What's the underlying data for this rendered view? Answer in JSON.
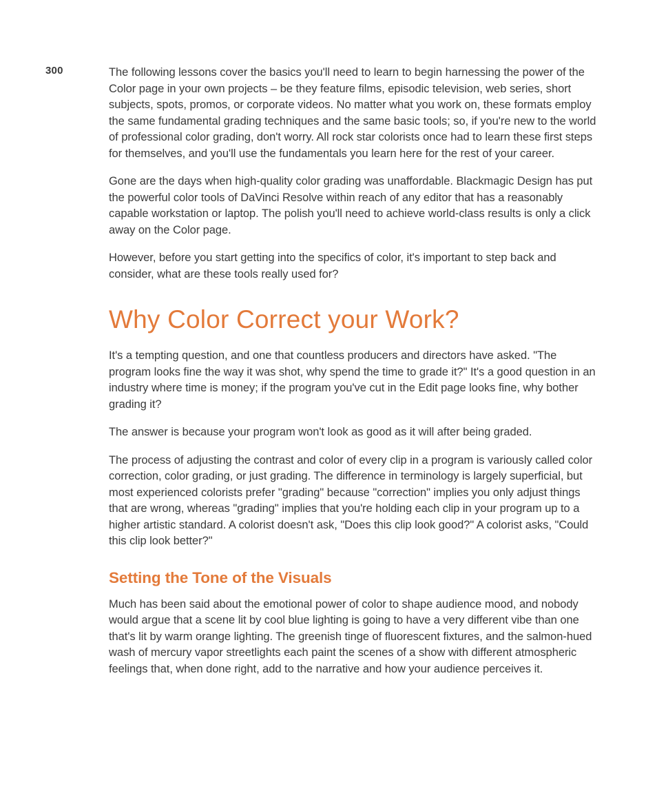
{
  "page_number": "300",
  "paragraphs": {
    "p1": "The following lessons cover the basics you'll need to learn to begin harnessing the power of the Color page in your own projects – be they feature films, episodic television, web series, short subjects, spots, promos, or corporate videos. No matter what you work on, these formats employ the same fundamental grading techniques and the same basic tools; so, if you're new to the world of professional color grading, don't worry. All rock star colorists once had to learn these first steps for themselves, and you'll use the fundamentals you learn here for the rest of your career.",
    "p2": "Gone are the days when high-quality color grading was unaffordable. Blackmagic Design has put the powerful color tools of DaVinci Resolve within reach of any editor that has a reasonably capable workstation or laptop. The polish you'll need to achieve world-class results is only a click away on the Color page.",
    "p3": "However, before you start getting into the specifics of color, it's important to step back and consider, what are these tools really used for?",
    "p4": "It's a tempting question, and one that countless producers and directors have asked. \"The program looks fine the way it was shot, why spend the time to grade it?\" It's a good question in an industry where time is money; if the program you've cut in the Edit page looks fine, why bother grading it?",
    "p5": "The answer is because your program won't look as good as it will after being graded.",
    "p6": "The process of adjusting the contrast and color of every clip in a program is variously called color correction, color grading, or just grading. The difference in terminology is largely superficial, but most experienced colorists prefer \"grading\" because \"correction\" implies you only adjust things that are wrong, whereas \"grading\" implies that you're holding each clip in your program up to a higher artistic standard. A colorist doesn't ask, \"Does this clip look good?\" A colorist asks, \"Could this clip look better?\"",
    "p7": "Much has been said about the emotional power of color to shape audience mood, and nobody would argue that a scene lit by cool blue lighting is going to have a very different vibe than one that's lit by warm orange lighting. The greenish tinge of fluorescent fixtures, and the salmon-hued wash of mercury vapor streetlights each paint the scenes of a show with different atmospheric feelings that, when done right, add to the narrative and how your audience perceives it."
  },
  "headings": {
    "h1": "Why Color Correct your Work?",
    "h2": "Setting the Tone of the Visuals"
  }
}
